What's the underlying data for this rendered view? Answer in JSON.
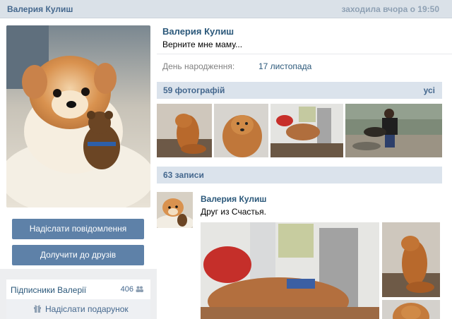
{
  "header": {
    "name": "Валерия Кулиш",
    "last_seen": "заходила вчора о 19:50"
  },
  "sidebar": {
    "send_message": "Надіслати повідомлення",
    "add_friend": "Долучити до друзів",
    "followers_label": "Підписники Валерії",
    "followers_count": "406",
    "gift_label": "Надіслати подарунок"
  },
  "profile": {
    "name": "Валерия Кулиш",
    "status": "Верните мне маму...",
    "birthday_label": "День народження:",
    "birthday_value": "17 листопада"
  },
  "photos": {
    "title": "59 фотографій",
    "all_link": "усі"
  },
  "wall": {
    "title": "63 записи",
    "post_author": "Валерия Кулиш",
    "post_text": "Друг из Счастья."
  },
  "icons": {
    "followers": "people-icon",
    "gift": "gift-icon"
  },
  "colors": {
    "accent": "#5e81a8",
    "link": "#2b587a",
    "header_bg": "#dae1e8",
    "section_bg": "#dbe3ec"
  }
}
